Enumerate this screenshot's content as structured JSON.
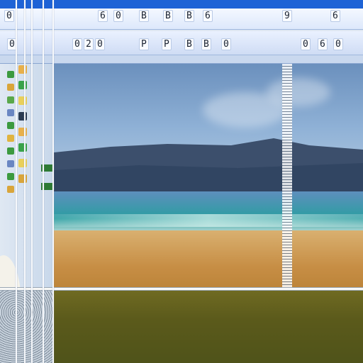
{
  "colors": {
    "titlebar": "#1e63d6",
    "toolbar": "#e6eefc",
    "sky": "#8fb1d6",
    "sea": "#2a9ea1",
    "sand": "#c78e45",
    "grass": "#5b5a1b"
  },
  "toolbar_top": {
    "buttons": [
      {
        "label": "0",
        "icon": "document-icon"
      },
      {
        "label": "6",
        "icon": "tool-icon"
      },
      {
        "label": "0",
        "icon": "tool-icon"
      },
      {
        "label": "B",
        "icon": "tool-icon"
      },
      {
        "label": "B",
        "icon": "tool-icon"
      },
      {
        "label": "B",
        "icon": "tool-icon"
      },
      {
        "label": "6",
        "icon": "tool-icon"
      },
      {
        "label": "9",
        "icon": "tool-icon"
      },
      {
        "label": "6",
        "icon": "tool-icon"
      }
    ]
  },
  "toolbar_second": {
    "buttons": [
      {
        "label": "0",
        "icon": "tool-icon"
      },
      {
        "label": "0",
        "icon": "tool-icon"
      },
      {
        "label": "2",
        "icon": "tool-icon"
      },
      {
        "label": "0",
        "icon": "tool-icon"
      },
      {
        "label": "P",
        "icon": "tool-icon"
      },
      {
        "label": "P",
        "icon": "tool-icon"
      },
      {
        "label": "B",
        "icon": "tool-icon"
      },
      {
        "label": "B",
        "icon": "tool-icon"
      },
      {
        "label": "0",
        "icon": "tool-icon"
      },
      {
        "label": "0",
        "icon": "tool-icon"
      },
      {
        "label": "6",
        "icon": "tool-icon"
      },
      {
        "label": "0",
        "icon": "tool-icon"
      }
    ]
  },
  "canvas": {
    "content": "beach-landscape-image"
  }
}
